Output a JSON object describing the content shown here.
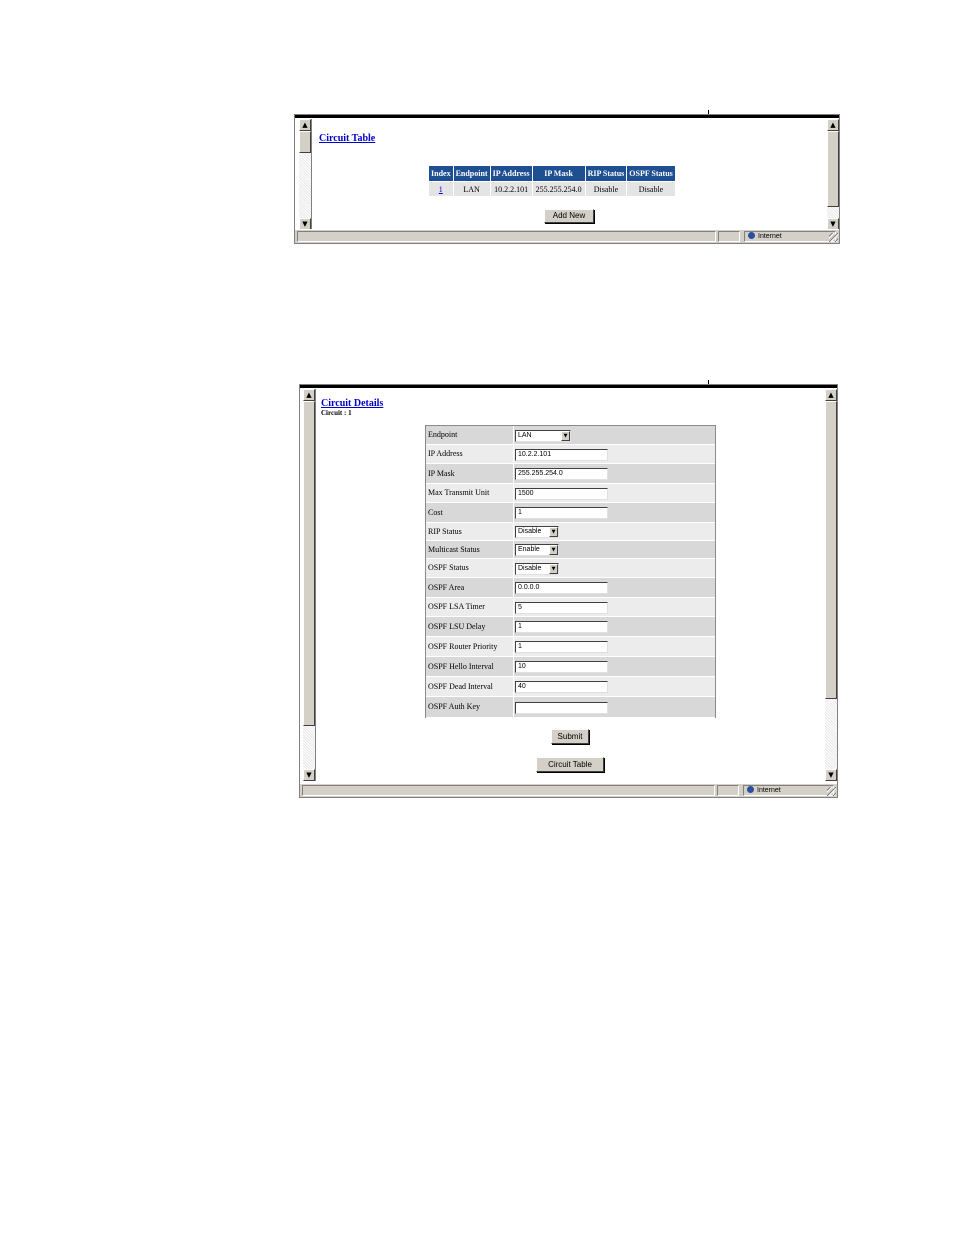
{
  "circuit_table_screen": {
    "title": "Circuit Table",
    "columns": [
      "Index",
      "Endpoint",
      "IP Address",
      "IP Mask",
      "RIP Status",
      "OSPF Status"
    ],
    "rows": [
      {
        "index": "1",
        "endpoint": "LAN",
        "ip_address": "10.2.2.101",
        "ip_mask": "255.255.254.0",
        "rip_status": "Disable",
        "ospf_status": "Disable"
      }
    ],
    "add_new_label": "Add New",
    "status_zone": "Internet"
  },
  "circuit_details_screen": {
    "title": "Circuit Details",
    "subtitle": "Circuit : 1",
    "fields": [
      {
        "label": "Endpoint",
        "value": "LAN",
        "kind": "select"
      },
      {
        "label": "IP Address",
        "value": "10.2.2.101",
        "kind": "text"
      },
      {
        "label": "IP Mask",
        "value": "255.255.254.0",
        "kind": "text"
      },
      {
        "label": "Max Transmit Unit",
        "value": "1500",
        "kind": "text"
      },
      {
        "label": "Cost",
        "value": "1",
        "kind": "text"
      },
      {
        "label": "RIP Status",
        "value": "Disable",
        "kind": "select"
      },
      {
        "label": "Multicast Status",
        "value": "Enable",
        "kind": "select"
      },
      {
        "label": "OSPF Status",
        "value": "Disable",
        "kind": "select"
      },
      {
        "label": "OSPF Area",
        "value": "0.0.0.0",
        "kind": "text"
      },
      {
        "label": "OSPF LSA Timer",
        "value": "5",
        "kind": "text"
      },
      {
        "label": "OSPF LSU Delay",
        "value": "1",
        "kind": "text"
      },
      {
        "label": "OSPF Router Priority",
        "value": "1",
        "kind": "text"
      },
      {
        "label": "OSPF Hello Interval",
        "value": "10",
        "kind": "text"
      },
      {
        "label": "OSPF Dead Interval",
        "value": "40",
        "kind": "text"
      },
      {
        "label": "OSPF Auth Key",
        "value": "",
        "kind": "text"
      }
    ],
    "submit_label": "Submit",
    "circuit_table_label": "Circuit Table",
    "status_zone": "Internet"
  },
  "colors": {
    "header_blue": "#1f4f93",
    "link_blue": "#0000cc",
    "chrome_gray": "#d4d0c8"
  }
}
